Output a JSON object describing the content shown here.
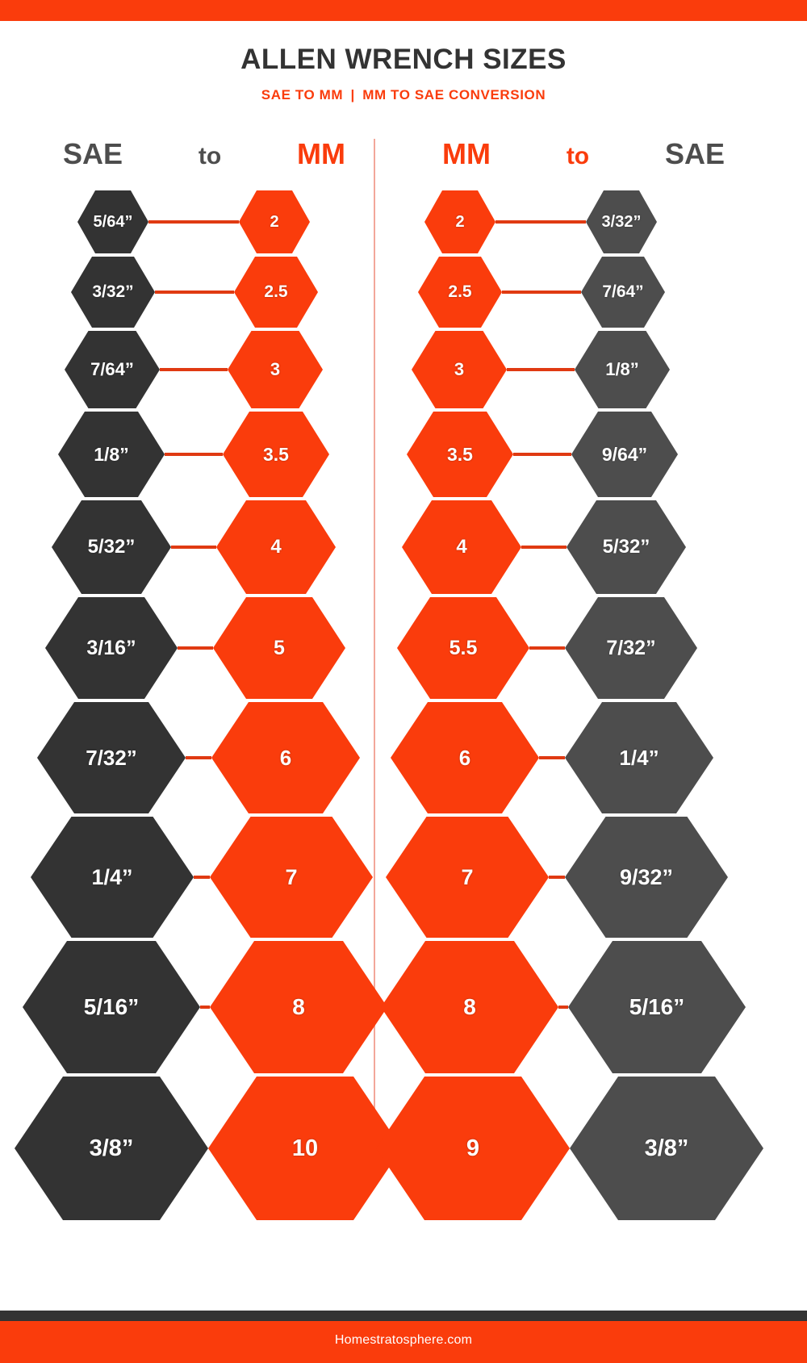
{
  "header": {
    "title": "ALLEN WRENCH SIZES",
    "subtitle_left": "SAE TO MM",
    "subtitle_sep": "|",
    "subtitle_right": "MM TO SAE CONVERSION"
  },
  "columns": {
    "left": {
      "from": "SAE",
      "to": "to",
      "target": "MM"
    },
    "right": {
      "from": "MM",
      "to": "to",
      "target": "SAE"
    }
  },
  "colors": {
    "accent_red": "#fa3c0c",
    "dark_left": "#333333",
    "dark_right": "#4d4d4d",
    "background": "#ffffff",
    "divider": "#f2a79a"
  },
  "footer": {
    "text": "Homestratosphere.com"
  },
  "chart_data": {
    "type": "table",
    "title": "ALLEN WRENCH SIZES",
    "subtitle": "SAE TO MM | MM TO SAE CONVERSION",
    "tables": [
      {
        "name": "SAE to MM",
        "columns": [
          "SAE",
          "MM"
        ],
        "rows": [
          {
            "sae": "5/64”",
            "mm": "2"
          },
          {
            "sae": "3/32”",
            "mm": "2.5"
          },
          {
            "sae": "7/64”",
            "mm": "3"
          },
          {
            "sae": "1/8”",
            "mm": "3.5"
          },
          {
            "sae": "5/32”",
            "mm": "4"
          },
          {
            "sae": "3/16”",
            "mm": "5"
          },
          {
            "sae": "7/32”",
            "mm": "6"
          },
          {
            "sae": "1/4”",
            "mm": "7"
          },
          {
            "sae": "5/16”",
            "mm": "8"
          },
          {
            "sae": "3/8”",
            "mm": "10"
          }
        ]
      },
      {
        "name": "MM to SAE",
        "columns": [
          "MM",
          "SAE"
        ],
        "rows": [
          {
            "mm": "2",
            "sae": "3/32”"
          },
          {
            "mm": "2.5",
            "sae": "7/64”"
          },
          {
            "mm": "3",
            "sae": "1/8”"
          },
          {
            "mm": "3.5",
            "sae": "9/64”"
          },
          {
            "mm": "4",
            "sae": "5/32”"
          },
          {
            "mm": "5.5",
            "sae": "7/32”"
          },
          {
            "mm": "6",
            "sae": "1/4”"
          },
          {
            "mm": "7",
            "sae": "9/32”"
          },
          {
            "mm": "8",
            "sae": "5/16”"
          },
          {
            "mm": "9",
            "sae": "3/8”"
          }
        ]
      }
    ]
  },
  "geometry": {
    "left_rows": [
      {
        "hex_w": 88,
        "hex_h": 78,
        "font": 20,
        "conn": 112,
        "pad": 96,
        "gap_after": 4
      },
      {
        "hex_w": 104,
        "hex_h": 88,
        "font": 21,
        "conn": 98,
        "pad": 88,
        "gap_after": 4
      },
      {
        "hex_w": 118,
        "hex_h": 96,
        "font": 22,
        "conn": 84,
        "pad": 80,
        "gap_after": 4
      },
      {
        "hex_w": 132,
        "hex_h": 106,
        "font": 23,
        "conn": 72,
        "pad": 72,
        "gap_after": 4
      },
      {
        "hex_w": 148,
        "hex_h": 116,
        "font": 24,
        "conn": 56,
        "pad": 64,
        "gap_after": 4
      },
      {
        "hex_w": 164,
        "hex_h": 126,
        "font": 25,
        "conn": 44,
        "pad": 56,
        "gap_after": 4
      },
      {
        "hex_w": 184,
        "hex_h": 138,
        "font": 26,
        "conn": 32,
        "pad": 46,
        "gap_after": 4
      },
      {
        "hex_w": 202,
        "hex_h": 150,
        "font": 27,
        "conn": 20,
        "pad": 38,
        "gap_after": 4
      },
      {
        "hex_w": 220,
        "hex_h": 164,
        "font": 28,
        "conn": 12,
        "pad": 28,
        "gap_after": 4
      },
      {
        "hex_w": 240,
        "hex_h": 178,
        "font": 29,
        "conn": 0,
        "pad": 18,
        "gap_after": 0
      }
    ],
    "right_rows": [
      {
        "hex_w": 88,
        "hex_h": 78,
        "font": 20,
        "conn": 112,
        "pad": 60,
        "gap_after": 4
      },
      {
        "hex_w": 104,
        "hex_h": 88,
        "font": 21,
        "conn": 98,
        "pad": 52,
        "gap_after": 4
      },
      {
        "hex_w": 118,
        "hex_h": 96,
        "font": 22,
        "conn": 84,
        "pad": 44,
        "gap_after": 4
      },
      {
        "hex_w": 132,
        "hex_h": 106,
        "font": 23,
        "conn": 72,
        "pad": 38,
        "gap_after": 4
      },
      {
        "hex_w": 148,
        "hex_h": 116,
        "font": 24,
        "conn": 56,
        "pad": 32,
        "gap_after": 4
      },
      {
        "hex_w": 164,
        "hex_h": 126,
        "font": 25,
        "conn": 44,
        "pad": 26,
        "gap_after": 4
      },
      {
        "hex_w": 184,
        "hex_h": 138,
        "font": 26,
        "conn": 32,
        "pad": 18,
        "gap_after": 4
      },
      {
        "hex_w": 202,
        "hex_h": 150,
        "font": 27,
        "conn": 20,
        "pad": 12,
        "gap_after": 4
      },
      {
        "hex_w": 220,
        "hex_h": 164,
        "font": 28,
        "conn": 12,
        "pad": 6,
        "gap_after": 4
      },
      {
        "hex_w": 240,
        "hex_h": 178,
        "font": 29,
        "conn": 0,
        "pad": 0,
        "gap_after": 0
      }
    ]
  }
}
